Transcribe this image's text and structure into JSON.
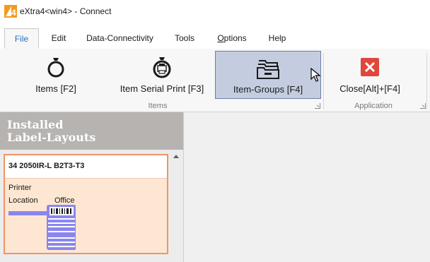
{
  "window": {
    "title": "eXtra4<win4>  -  Connect",
    "logo_letter": "4"
  },
  "menu": {
    "tabs": [
      {
        "label": "File",
        "active": true
      },
      {
        "label": "Edit"
      },
      {
        "label": "Data-Connectivity"
      },
      {
        "label": "Tools"
      },
      {
        "label_pre": "",
        "label_u": "O",
        "label_post": "ptions"
      },
      {
        "label": "Help"
      }
    ]
  },
  "ribbon": {
    "buttons": [
      {
        "label": "Items [F2]",
        "icon": "ring-icon"
      },
      {
        "label": "Item Serial Print [F3]",
        "icon": "ring-printer-icon"
      },
      {
        "label": "Item-Groups [F4]",
        "icon": "folder-stack-icon",
        "selected": true
      },
      {
        "label": "Close[Alt]+[F4]",
        "icon": "close-icon"
      }
    ],
    "groups": [
      "Items",
      "Application"
    ]
  },
  "left_panel": {
    "title_line1": "Installed",
    "title_line2": "Label-Layouts",
    "card": {
      "title": "34 2050IR-L B2T3-T3",
      "printer_label": "Printer",
      "location_label": "Location",
      "location_value": "Office"
    }
  },
  "colors": {
    "ribbon_selected_bg": "#c4cde0",
    "card_bg": "#fde7d2",
    "card_border": "#f1936a",
    "close_red": "#e0463b",
    "printer_purple": "#8b85f0",
    "active_tab_text": "#2a6ebb"
  }
}
